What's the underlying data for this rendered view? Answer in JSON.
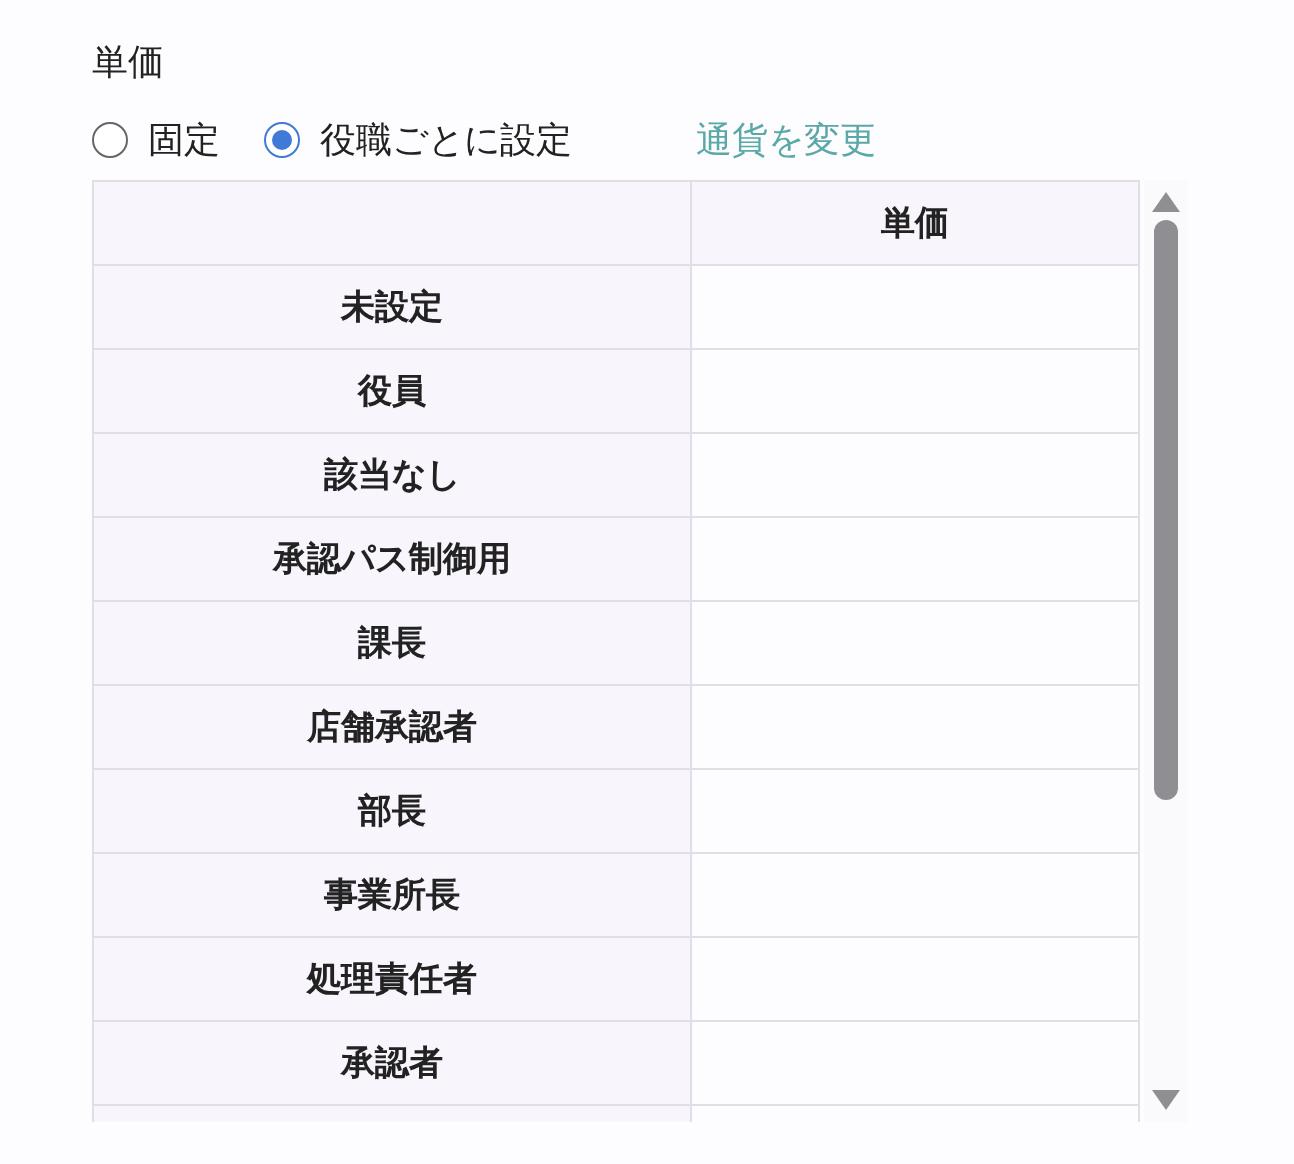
{
  "field_label": "単価",
  "price_mode": [
    {
      "label": "固定",
      "selected": false
    },
    {
      "label": "役職ごとに設定",
      "selected": true
    }
  ],
  "change_currency_link": "通貨を変更",
  "table": {
    "columns": [
      "",
      "単価"
    ],
    "rows": [
      {
        "role": "未設定",
        "price": ""
      },
      {
        "role": "役員",
        "price": ""
      },
      {
        "role": "該当なし",
        "price": ""
      },
      {
        "role": "承認パス制御用",
        "price": ""
      },
      {
        "role": "課長",
        "price": ""
      },
      {
        "role": "店舗承認者",
        "price": ""
      },
      {
        "role": "部長",
        "price": ""
      },
      {
        "role": "事業所長",
        "price": ""
      },
      {
        "role": "処理責任者",
        "price": ""
      },
      {
        "role": "承認者",
        "price": ""
      }
    ]
  }
}
